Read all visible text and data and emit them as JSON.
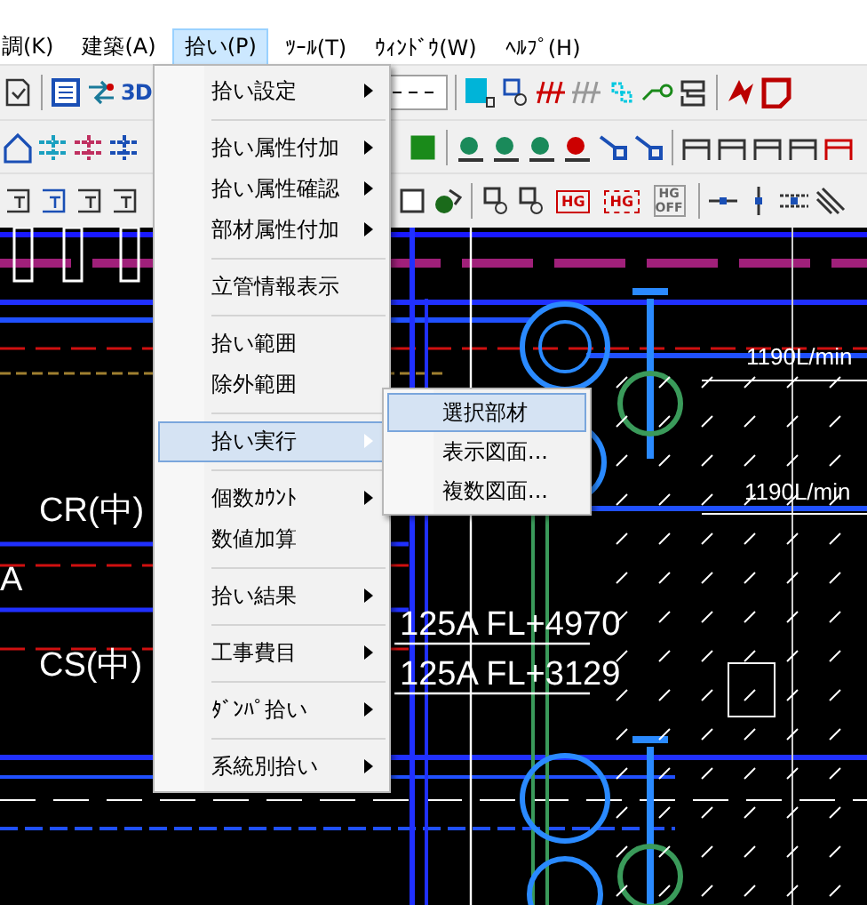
{
  "menu_bar": [
    {
      "label": "調(K)",
      "selected": false
    },
    {
      "label": "建築(A)",
      "selected": false
    },
    {
      "label": "拾い(P)",
      "selected": true
    },
    {
      "label": "ﾂｰﾙ(T)",
      "selected": false
    },
    {
      "label": "ｳｨﾝﾄﾞｳ(W)",
      "selected": false
    },
    {
      "label": "ﾍﾙﾌﾟ(H)",
      "selected": false
    }
  ],
  "toolbar_buttons": [
    {
      "label": "3D",
      "kind": "bold"
    },
    {
      "label": "HG",
      "kind": "hg"
    },
    {
      "label": "HG",
      "kind": "hg-dashed"
    },
    {
      "label": "HG OFF",
      "kind": "hg-off"
    }
  ],
  "dropdown": {
    "groups": [
      [
        {
          "label": "拾い設定",
          "submenu": true,
          "selected": false
        }
      ],
      [
        {
          "label": "拾い属性付加",
          "submenu": true,
          "selected": false
        },
        {
          "label": "拾い属性確認",
          "submenu": true,
          "selected": false
        },
        {
          "label": "部材属性付加",
          "submenu": true,
          "selected": false
        }
      ],
      [
        {
          "label": "立管情報表示",
          "submenu": false,
          "selected": false
        }
      ],
      [
        {
          "label": "拾い範囲",
          "submenu": false,
          "selected": false
        },
        {
          "label": "除外範囲",
          "submenu": false,
          "selected": false
        }
      ],
      [
        {
          "label": "拾い実行",
          "submenu": true,
          "selected": true
        }
      ],
      [
        {
          "label": "個数ｶｳﾝﾄ",
          "submenu": true,
          "selected": false
        },
        {
          "label": "数値加算",
          "submenu": false,
          "selected": false
        }
      ],
      [
        {
          "label": "拾い結果",
          "submenu": true,
          "selected": false
        }
      ],
      [
        {
          "label": "工事費目",
          "submenu": true,
          "selected": false
        }
      ],
      [
        {
          "label": "ﾀﾞﾝﾊﾟ拾い",
          "submenu": true,
          "selected": false
        }
      ],
      [
        {
          "label": "系統別拾い",
          "submenu": true,
          "selected": false
        }
      ]
    ]
  },
  "submenu": {
    "items": [
      {
        "label": "選択部材",
        "selected": true
      },
      {
        "label": "表示図面...",
        "selected": false
      },
      {
        "label": "複数図面...",
        "selected": false
      }
    ]
  },
  "canvas": {
    "labels": [
      {
        "text": "CR(中)"
      },
      {
        "text": "A"
      },
      {
        "text": "CS(中)"
      },
      {
        "text": "125A FL+4970"
      },
      {
        "text": "125A FL+3129"
      },
      {
        "text": "1190L/min"
      },
      {
        "text": "1190L/min"
      }
    ]
  }
}
